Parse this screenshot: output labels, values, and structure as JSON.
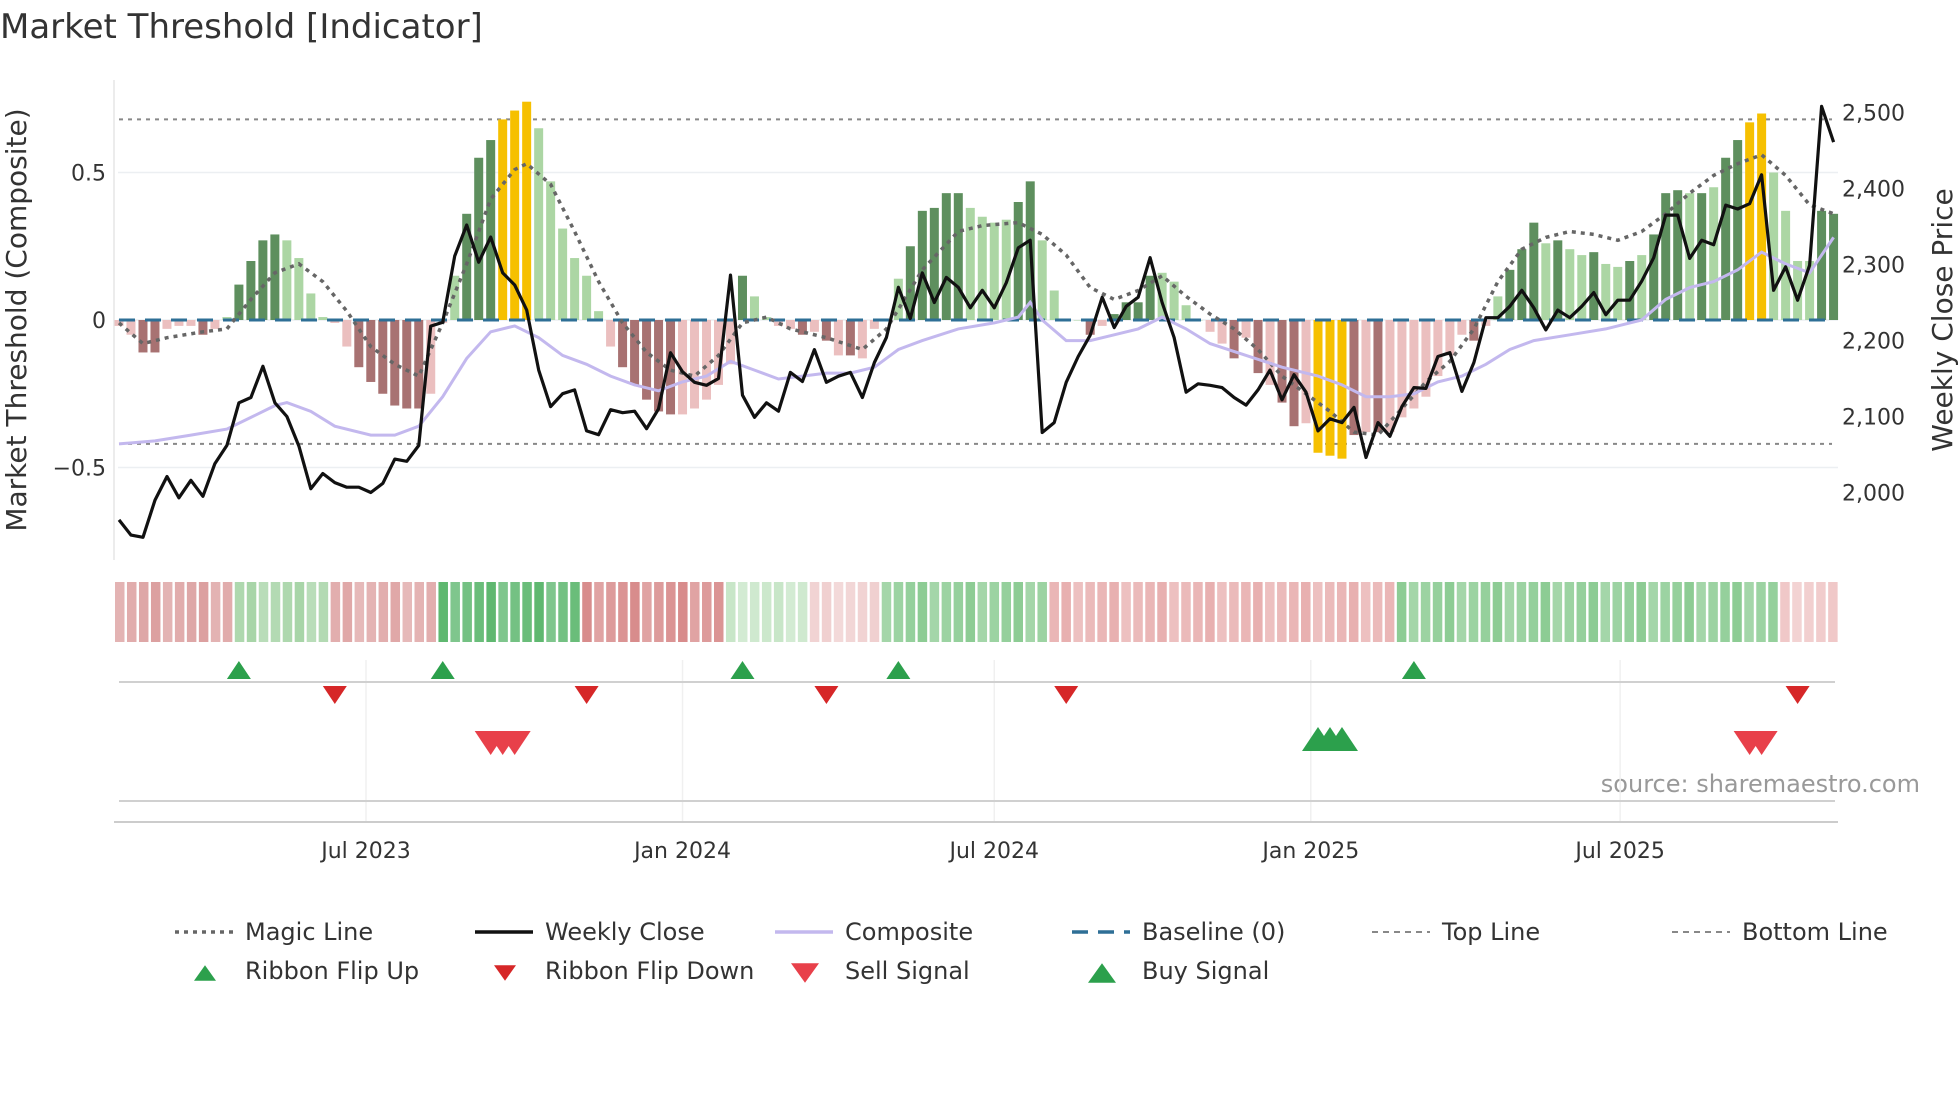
{
  "chart_data": {
    "type": "bar",
    "title": "Market Threshold [Indicator]",
    "ylabel": "Market Threshold (Composite)",
    "y2label": "Weekly Close Price",
    "ylim": [
      -0.82,
      0.82
    ],
    "y2lim": [
      1925,
      2565
    ],
    "yticks": [
      {
        "v": 0.5,
        "label": "0.5"
      },
      {
        "v": 0,
        "label": "0"
      },
      {
        "v": -0.5,
        "label": "−0.5"
      }
    ],
    "y2ticks": [
      {
        "v": 2500,
        "label": "2,500"
      },
      {
        "v": 2400,
        "label": "2,400"
      },
      {
        "v": 2300,
        "label": "2,300"
      },
      {
        "v": 2200,
        "label": "2,200"
      },
      {
        "v": 2100,
        "label": "2,100"
      },
      {
        "v": 2000,
        "label": "2,000"
      }
    ],
    "xticks": [
      {
        "week": 20.6,
        "label": "Jul 2023"
      },
      {
        "week": 47,
        "label": "Jan 2024"
      },
      {
        "week": 73,
        "label": "Jul 2024"
      },
      {
        "week": 99.4,
        "label": "Jan 2025"
      },
      {
        "week": 125.2,
        "label": "Jul 2025"
      }
    ],
    "top_line": 0.68,
    "bottom_line": -0.42,
    "baseline": 0,
    "composite_bars": [
      -0.02,
      -0.05,
      -0.11,
      -0.11,
      -0.03,
      -0.02,
      -0.02,
      -0.05,
      -0.03,
      0.01,
      0.12,
      0.2,
      0.27,
      0.29,
      0.27,
      0.21,
      0.09,
      0.01,
      -0.01,
      -0.09,
      -0.16,
      -0.21,
      -0.25,
      -0.29,
      -0.3,
      -0.3,
      -0.25,
      -0.01,
      0.15,
      0.36,
      0.55,
      0.61,
      0.68,
      0.71,
      0.74,
      0.65,
      0.47,
      0.31,
      0.21,
      0.15,
      0.03,
      -0.09,
      -0.16,
      -0.22,
      -0.27,
      -0.31,
      -0.32,
      -0.32,
      -0.3,
      -0.27,
      -0.22,
      -0.15,
      0.15,
      0.08,
      0.01,
      -0.02,
      -0.03,
      -0.05,
      -0.04,
      -0.07,
      -0.12,
      -0.12,
      -0.13,
      -0.03,
      0.0,
      0.14,
      0.25,
      0.37,
      0.38,
      0.43,
      0.43,
      0.38,
      0.35,
      0.33,
      0.34,
      0.4,
      0.47,
      0.27,
      0.1,
      0.0,
      0.0,
      -0.05,
      -0.02,
      0.02,
      0.06,
      0.06,
      0.15,
      0.16,
      0.13,
      0.05,
      0.0,
      -0.04,
      -0.08,
      -0.13,
      -0.06,
      -0.18,
      -0.22,
      -0.28,
      -0.36,
      -0.35,
      -0.45,
      -0.46,
      -0.47,
      -0.39,
      -0.38,
      -0.38,
      -0.38,
      -0.33,
      -0.3,
      -0.26,
      -0.19,
      -0.12,
      -0.05,
      -0.07,
      -0.02,
      0.08,
      0.17,
      0.24,
      0.33,
      0.26,
      0.27,
      0.24,
      0.22,
      0.23,
      0.19,
      0.18,
      0.2,
      0.22,
      0.29,
      0.43,
      0.44,
      0.43,
      0.43,
      0.45,
      0.55,
      0.61,
      0.67,
      0.7,
      0.5,
      0.37,
      0.2,
      0.2,
      0.37,
      0.36
    ],
    "bar_classes": "PPRRPPPRPLDDDDLLLLPPRRRRRRPPLDDDYYYLLLLLLPRRRRRPPPPPDLLPPRPRPRPPLLDDDDDLLLLDDLLLLRPDDDDLLLLPPRPRPRRPYYYRPRPPPPPPPRPLDDDLDLLDLLDLDDDLDLDDYYLLLLDD",
    "bar_colors": {
      "D": "#5e8f5e",
      "L": "#acd6a4",
      "R": "#a87272",
      "P": "#ebbfbf",
      "Y": "#f6c000"
    },
    "weekly_close": [
      1964,
      1944,
      1941,
      1990,
      2021,
      1993,
      2016,
      1995,
      2038,
      2062,
      2118,
      2125,
      2166,
      2118,
      2100,
      2061,
      2005,
      2025,
      2013,
      2007,
      2007,
      2000,
      2012,
      2044,
      2041,
      2062,
      2219,
      2224,
      2311,
      2352,
      2303,
      2336,
      2289,
      2273,
      2240,
      2161,
      2113,
      2130,
      2135,
      2081,
      2076,
      2109,
      2105,
      2107,
      2084,
      2110,
      2184,
      2159,
      2145,
      2141,
      2150,
      2286,
      2128,
      2099,
      2118,
      2107,
      2158,
      2146,
      2188,
      2145,
      2153,
      2158,
      2125,
      2171,
      2204,
      2270,
      2229,
      2289,
      2250,
      2283,
      2270,
      2243,
      2266,
      2243,
      2276,
      2322,
      2332,
      2079,
      2092,
      2145,
      2179,
      2207,
      2257,
      2217,
      2245,
      2257,
      2309,
      2250,
      2204,
      2132,
      2143,
      2141,
      2138,
      2125,
      2115,
      2135,
      2161,
      2122,
      2155,
      2132,
      2081,
      2097,
      2092,
      2112,
      2046,
      2092,
      2074,
      2113,
      2138,
      2137,
      2179,
      2184,
      2133,
      2171,
      2230,
      2230,
      2245,
      2266,
      2243,
      2214,
      2240,
      2230,
      2245,
      2263,
      2234,
      2253,
      2253,
      2278,
      2309,
      2365,
      2365,
      2308,
      2332,
      2326,
      2378,
      2373,
      2380,
      2418,
      2266,
      2297,
      2253,
      2299,
      2508,
      2461
    ],
    "magic_line": [
      [
        0,
        -0.01
      ],
      [
        2,
        -0.08
      ],
      [
        4,
        -0.06
      ],
      [
        7,
        -0.04
      ],
      [
        9,
        -0.03
      ],
      [
        11,
        0.07
      ],
      [
        13,
        0.16
      ],
      [
        15,
        0.19
      ],
      [
        17,
        0.13
      ],
      [
        19,
        0.03
      ],
      [
        21,
        -0.09
      ],
      [
        23,
        -0.15
      ],
      [
        25,
        -0.19
      ],
      [
        27,
        -0.01
      ],
      [
        29,
        0.19
      ],
      [
        31,
        0.41
      ],
      [
        33,
        0.51
      ],
      [
        34,
        0.53
      ],
      [
        36,
        0.46
      ],
      [
        38,
        0.3
      ],
      [
        40,
        0.13
      ],
      [
        42,
        -0.01
      ],
      [
        44,
        -0.11
      ],
      [
        46,
        -0.17
      ],
      [
        48,
        -0.19
      ],
      [
        50,
        -0.12
      ],
      [
        52,
        -0.01
      ],
      [
        54,
        0.01
      ],
      [
        56,
        -0.03
      ],
      [
        59,
        -0.06
      ],
      [
        62,
        -0.1
      ],
      [
        64,
        -0.03
      ],
      [
        67,
        0.17
      ],
      [
        70,
        0.3
      ],
      [
        72,
        0.32
      ],
      [
        75,
        0.33
      ],
      [
        77,
        0.29
      ],
      [
        79,
        0.22
      ],
      [
        81,
        0.11
      ],
      [
        83,
        0.07
      ],
      [
        85,
        0.1
      ],
      [
        87,
        0.15
      ],
      [
        89,
        0.08
      ],
      [
        91,
        0.02
      ],
      [
        93,
        -0.03
      ],
      [
        95,
        -0.1
      ],
      [
        97,
        -0.19
      ],
      [
        99,
        -0.25
      ],
      [
        101,
        -0.31
      ],
      [
        103,
        -0.38
      ],
      [
        105,
        -0.39
      ],
      [
        107,
        -0.3
      ],
      [
        109,
        -0.21
      ],
      [
        111,
        -0.14
      ],
      [
        113,
        -0.03
      ],
      [
        115,
        0.13
      ],
      [
        117,
        0.24
      ],
      [
        119,
        0.28
      ],
      [
        121,
        0.3
      ],
      [
        123,
        0.29
      ],
      [
        125,
        0.27
      ],
      [
        127,
        0.3
      ],
      [
        129,
        0.36
      ],
      [
        131,
        0.43
      ],
      [
        133,
        0.49
      ],
      [
        135,
        0.53
      ],
      [
        137,
        0.56
      ],
      [
        139,
        0.49
      ],
      [
        141,
        0.39
      ],
      [
        143,
        0.36
      ]
    ],
    "composite_line": [
      [
        0,
        -0.42
      ],
      [
        3,
        -0.41
      ],
      [
        6,
        -0.39
      ],
      [
        9,
        -0.37
      ],
      [
        11,
        -0.33
      ],
      [
        13,
        -0.29
      ],
      [
        14,
        -0.28
      ],
      [
        16,
        -0.31
      ],
      [
        18,
        -0.36
      ],
      [
        21,
        -0.39
      ],
      [
        23,
        -0.39
      ],
      [
        25,
        -0.36
      ],
      [
        27,
        -0.26
      ],
      [
        29,
        -0.13
      ],
      [
        31,
        -0.04
      ],
      [
        33,
        -0.02
      ],
      [
        35,
        -0.06
      ],
      [
        37,
        -0.12
      ],
      [
        39,
        -0.15
      ],
      [
        41,
        -0.19
      ],
      [
        43,
        -0.22
      ],
      [
        45,
        -0.24
      ],
      [
        47,
        -0.21
      ],
      [
        49,
        -0.19
      ],
      [
        51,
        -0.14
      ],
      [
        53,
        -0.17
      ],
      [
        55,
        -0.2
      ],
      [
        57,
        -0.19
      ],
      [
        59,
        -0.18
      ],
      [
        61,
        -0.18
      ],
      [
        63,
        -0.16
      ],
      [
        65,
        -0.1
      ],
      [
        67,
        -0.07
      ],
      [
        70,
        -0.03
      ],
      [
        73,
        -0.01
      ],
      [
        75,
        0.01
      ],
      [
        76,
        0.06
      ],
      [
        77,
        0.0
      ],
      [
        79,
        -0.07
      ],
      [
        81,
        -0.07
      ],
      [
        83,
        -0.05
      ],
      [
        85,
        -0.03
      ],
      [
        87,
        0.01
      ],
      [
        89,
        -0.03
      ],
      [
        91,
        -0.08
      ],
      [
        94,
        -0.12
      ],
      [
        97,
        -0.16
      ],
      [
        100,
        -0.19
      ],
      [
        102,
        -0.22
      ],
      [
        104,
        -0.26
      ],
      [
        106,
        -0.26
      ],
      [
        108,
        -0.25
      ],
      [
        110,
        -0.21
      ],
      [
        112,
        -0.19
      ],
      [
        114,
        -0.15
      ],
      [
        116,
        -0.1
      ],
      [
        118,
        -0.07
      ],
      [
        121,
        -0.05
      ],
      [
        124,
        -0.03
      ],
      [
        127,
        0.0
      ],
      [
        129,
        0.07
      ],
      [
        131,
        0.11
      ],
      [
        133,
        0.13
      ],
      [
        135,
        0.17
      ],
      [
        137,
        0.23
      ],
      [
        139,
        0.19
      ],
      [
        141,
        0.16
      ],
      [
        143,
        0.28
      ]
    ],
    "ribbon_runs": [
      [
        10,
        "#dca0a0"
      ],
      [
        8,
        "#a8d5a8"
      ],
      [
        9,
        "#e0a8a8"
      ],
      [
        12,
        "#5fb870"
      ],
      [
        12,
        "#d88c8c"
      ],
      [
        7,
        "#c8e6c8"
      ],
      [
        6,
        "#f0d0d0"
      ],
      [
        14,
        "#8dcc94"
      ],
      [
        29,
        "#e8b0b0"
      ],
      [
        32,
        "#8dcc94"
      ],
      [
        5,
        "#f0c8c8"
      ]
    ],
    "ribbon_flip_up": [
      10,
      27,
      52,
      65,
      108
    ],
    "ribbon_flip_down": [
      18,
      39,
      59,
      79,
      140
    ],
    "sell_signals": [
      31,
      32,
      33,
      136,
      137
    ],
    "buy_signals": [
      100,
      101,
      102
    ],
    "legend": [
      {
        "label": "Magic Line",
        "kind": "dotted",
        "color": "#666666"
      },
      {
        "label": "Weekly Close",
        "kind": "solid",
        "color": "#111111"
      },
      {
        "label": "Composite",
        "kind": "solid",
        "color": "#c3b8ee"
      },
      {
        "label": "Baseline (0)",
        "kind": "dashed",
        "color": "#2e6f96"
      },
      {
        "label": "Top Line",
        "kind": "dashed-thin",
        "color": "#888888"
      },
      {
        "label": "Bottom Line",
        "kind": "dashed-thin",
        "color": "#888888"
      },
      {
        "label": "Ribbon Flip Up",
        "kind": "tri-up",
        "color": "#2ca04c"
      },
      {
        "label": "Ribbon Flip Down",
        "kind": "tri-down",
        "color": "#d62728"
      },
      {
        "label": "Sell Signal",
        "kind": "tri-down-big",
        "color": "#e8404a"
      },
      {
        "label": "Buy Signal",
        "kind": "tri-up-big",
        "color": "#2ca04c"
      }
    ],
    "source": "source: sharemaestro.com"
  }
}
